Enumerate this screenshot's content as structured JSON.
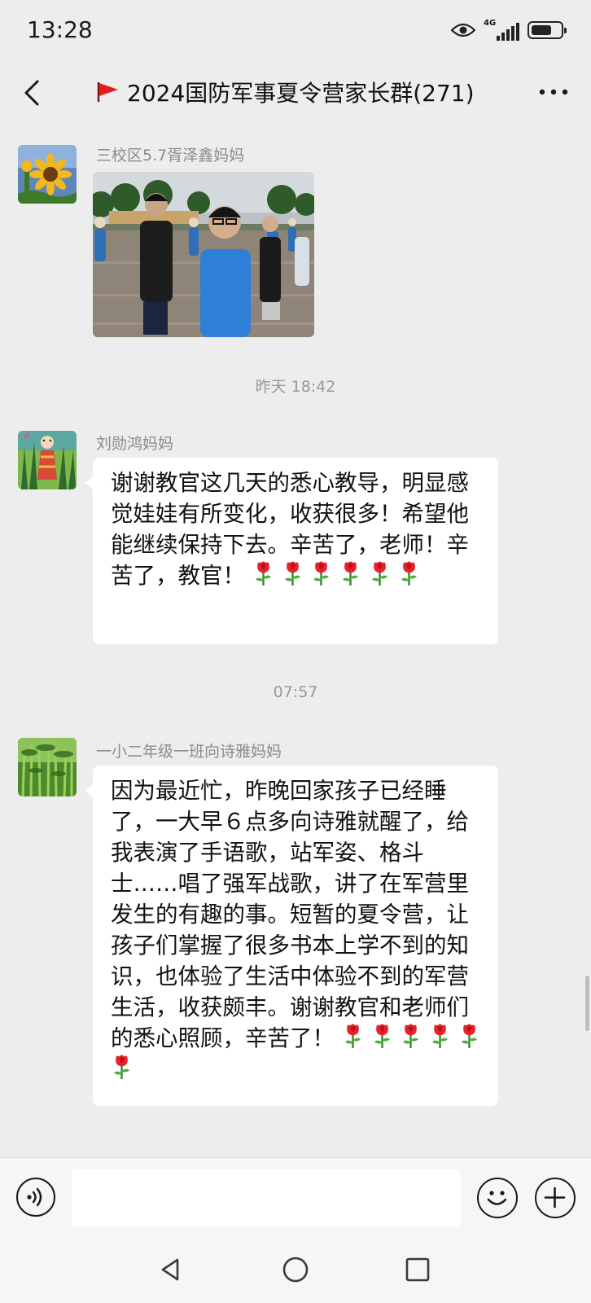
{
  "status_bar": {
    "time": "13:28",
    "network": "4G",
    "battery_level": 0.7,
    "icons": [
      "eye-icon",
      "signal-icon",
      "battery-icon"
    ]
  },
  "header": {
    "title": "2024国防军事夏令营家长群(271)",
    "back_icon": "chevron-left-icon",
    "flag_icon": "red-flag-icon",
    "more_icon": "more-dots-icon"
  },
  "messages": [
    {
      "sender": "三校区5.7胥泽鑫妈妈",
      "type": "image",
      "avatar_icon": "sunflower-avatar"
    },
    {
      "timestamp": "昨天 18:42"
    },
    {
      "sender": "刘勋鸿妈妈",
      "type": "text",
      "avatar_icon": "illustration-avatar",
      "text": "谢谢教官这几天的悉心教导，明显感觉娃娃有所变化，收获很多！希望他能继续保持下去。辛苦了，老师！辛苦了，教官！",
      "emoji": "rose-emoji",
      "emoji_count": 6
    },
    {
      "timestamp": "07:57"
    },
    {
      "sender": "一小二年级一班向诗雅妈妈",
      "type": "text",
      "avatar_icon": "bamboo-avatar",
      "text": "因为最近忙，昨晚回家孩子已经睡了，一大早６点多向诗雅就醒了，给我表演了手语歌，站军姿、格斗士……唱了强军战歌，讲了在军营里发生的有趣的事。短暂的夏令营，让孩子们掌握了很多书本上学不到的知识，也体验了生活中体验不到的军营生活，收获颇丰。谢谢教官和老师们的悉心照顾，辛苦了！",
      "emoji": "rose-emoji",
      "emoji_count": 6
    }
  ],
  "input_bar": {
    "placeholder": "",
    "icons": [
      "voice-icon",
      "emoji-icon",
      "plus-icon"
    ]
  },
  "system_nav": {
    "icons": [
      "back-triangle-icon",
      "home-circle-icon",
      "recents-square-icon"
    ]
  },
  "colors": {
    "background": "#ededed",
    "bubble": "#ffffff",
    "sender_text": "#8b8b8b",
    "timestamp_text": "#999999",
    "flag_red": "#e0201b"
  }
}
